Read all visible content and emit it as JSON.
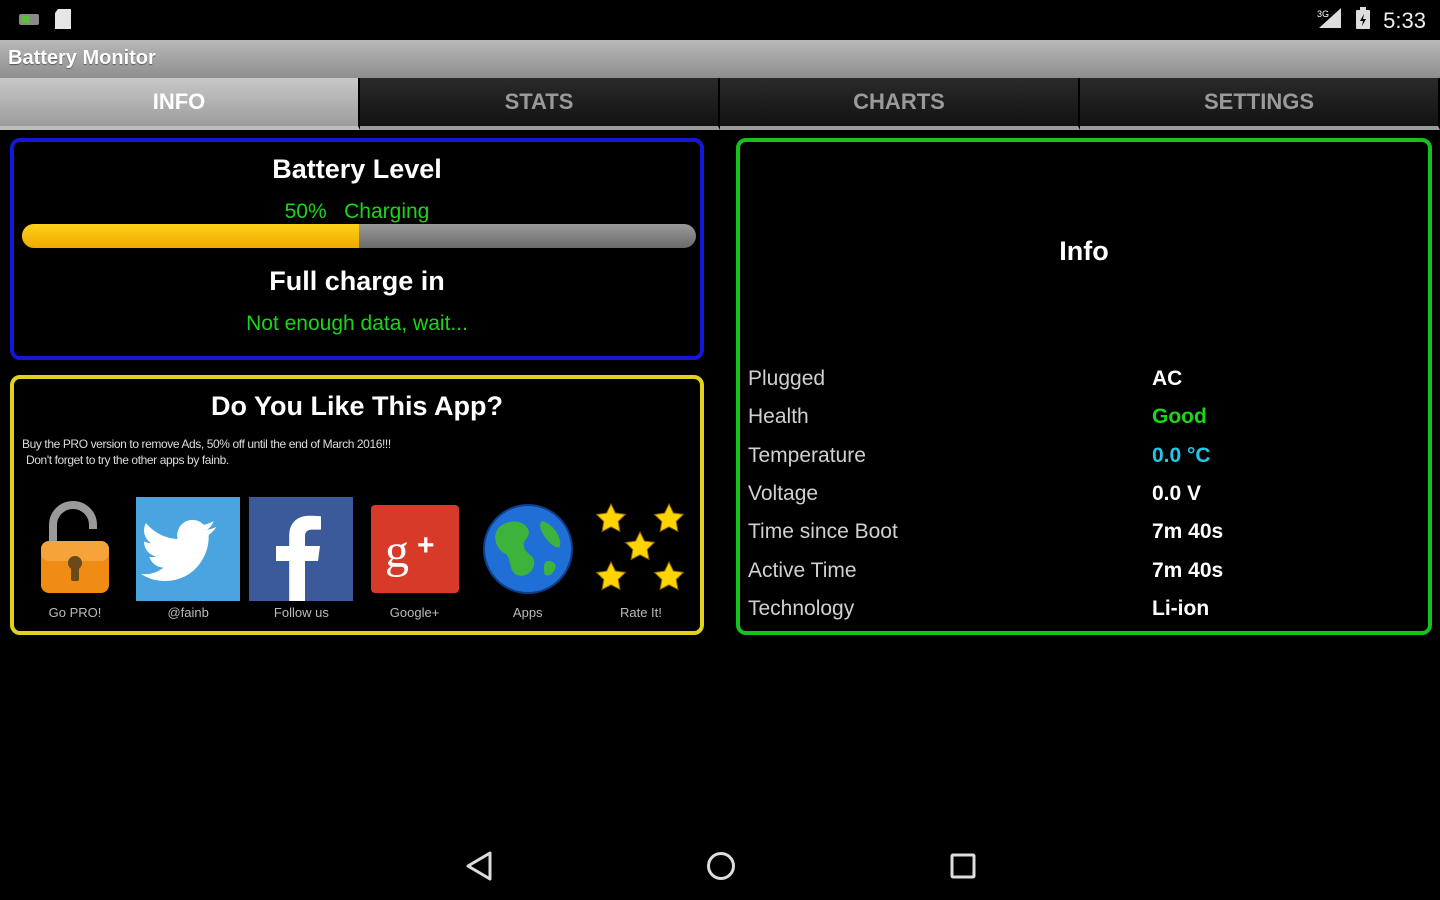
{
  "status_bar": {
    "time": "5:33",
    "network": "3G"
  },
  "app": {
    "title": "Battery Monitor"
  },
  "tabs": [
    {
      "label": "INFO",
      "active": true
    },
    {
      "label": "STATS",
      "active": false
    },
    {
      "label": "CHARTS",
      "active": false
    },
    {
      "label": "SETTINGS",
      "active": false
    }
  ],
  "battery": {
    "title": "Battery Level",
    "status_text": "50%   Charging",
    "level_percent": 50,
    "full_charge_title": "Full charge in",
    "full_charge_value": "Not enough data, wait..."
  },
  "promo": {
    "title": "Do You Like This App?",
    "line1": "Buy the PRO version to remove Ads, 50% off until the end of March 2016!!!",
    "line2": "Don't forget to try the other apps by fainb.",
    "apps": [
      {
        "label": "Go PRO!",
        "icon": "unlock-icon"
      },
      {
        "label": "@fainb",
        "icon": "twitter-icon"
      },
      {
        "label": "Follow us",
        "icon": "facebook-icon"
      },
      {
        "label": "Google+",
        "icon": "google-plus-icon"
      },
      {
        "label": "Apps",
        "icon": "globe-icon"
      },
      {
        "label": "Rate It!",
        "icon": "stars-icon"
      }
    ]
  },
  "info": {
    "title": "Info",
    "rows": [
      {
        "key": "Plugged",
        "value": "AC",
        "color": "#ffffff"
      },
      {
        "key": "Health",
        "value": "Good",
        "color": "#19d619"
      },
      {
        "key": "Temperature",
        "value": "0.0 °C",
        "color": "#1ec8e8"
      },
      {
        "key": "Voltage",
        "value": "0.0 V",
        "color": "#ffffff"
      },
      {
        "key": "Time since Boot",
        "value": "7m 40s",
        "color": "#ffffff"
      },
      {
        "key": "Active Time",
        "value": "7m 40s",
        "color": "#ffffff"
      },
      {
        "key": "Technology",
        "value": "Li-ion",
        "color": "#ffffff"
      }
    ]
  },
  "colors": {
    "battery_border": "#1616d8",
    "promo_border": "#e2d21c",
    "info_border": "#17c21a",
    "progress_fill": "#f5b800",
    "accent_green": "#19d619"
  }
}
